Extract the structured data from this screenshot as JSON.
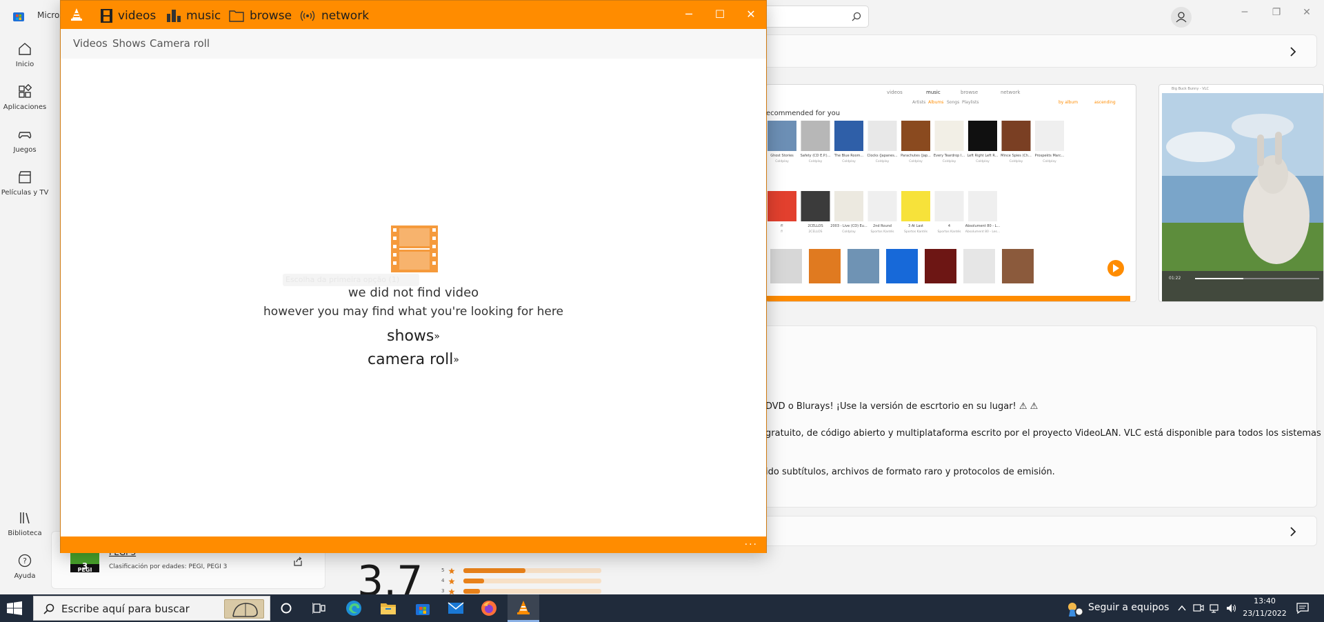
{
  "store": {
    "title": "Microsoft Store",
    "nav": [
      {
        "label": "Inicio"
      },
      {
        "label": "Aplicaciones"
      },
      {
        "label": "Juegos"
      },
      {
        "label": "Películas y TV"
      },
      {
        "label": "Biblioteca"
      },
      {
        "label": "Ayuda"
      }
    ],
    "description_lines": [
      "DVD o Blurays! ¡Use la versión de escrtorio en su lugar! ⚠ ⚠",
      "gratuito, de código abierto y multiplataforma escrito por el proyecto VideoLAN. VLC está disponible para todos los sistemas",
      "ido subtítulos, archivos de formato raro y protocolos de emisión."
    ],
    "rating": "3.7",
    "rating_bars": [
      {
        "stars": "5",
        "fraction": 0.45
      },
      {
        "stars": "4",
        "fraction": 0.15
      },
      {
        "stars": "3",
        "fraction": 0.12
      }
    ],
    "pegi": {
      "badge": "3",
      "logo_text": "PEGI",
      "label": "PEGI 3",
      "description": "Clasificación por edades: PEGI, PEGI 3"
    },
    "screenshot1": {
      "tabs": [
        "videos",
        "music",
        "browse",
        "network"
      ],
      "subtabs": [
        "Artists",
        "Albums",
        "Songs",
        "Playlists"
      ],
      "sort": [
        "by album",
        "ascending"
      ],
      "section": "ecommended for you",
      "albums_row1": [
        {
          "title": "Ghost Stories",
          "artist": "Coldplay"
        },
        {
          "title": "Safety (CD E.P.)...",
          "artist": "Coldplay"
        },
        {
          "title": "The Blue Room...",
          "artist": "Coldplay"
        },
        {
          "title": "Clocks (Japanes...",
          "artist": "Coldplay"
        },
        {
          "title": "Parachutes (Jap...",
          "artist": "Coldplay"
        },
        {
          "title": "Every Teardrop I...",
          "artist": "Coldplay"
        },
        {
          "title": "Left Right Left R...",
          "artist": "Coldplay"
        },
        {
          "title": "Mince Spies (Ch...",
          "artist": "Coldplay"
        },
        {
          "title": "Prospekts Marc...",
          "artist": "Coldplay"
        }
      ],
      "albums_row2": [
        {
          "title": "f!",
          "artist": "f!"
        },
        {
          "title": "2CELLOS",
          "artist": "2CELLOS"
        },
        {
          "title": "2003 - Live (CD) Eu...",
          "artist": "Coldplay"
        },
        {
          "title": "2nd Round",
          "artist": "Sportos Kantés"
        },
        {
          "title": "3 At Last",
          "artist": "Sportos Kantés"
        },
        {
          "title": "4",
          "artist": "Sportos Kantés"
        },
        {
          "title": "Absolument 80 - L...",
          "artist": "Absolument 80 - Les..."
        }
      ]
    },
    "screenshot2": {
      "title": "Big Buck Bunny - VLC",
      "time": "01:22"
    }
  },
  "vlc": {
    "tabs": [
      {
        "label": "videos",
        "icon": "film-icon"
      },
      {
        "label": "music",
        "icon": "equalizer-icon"
      },
      {
        "label": "browse",
        "icon": "folder-icon"
      },
      {
        "label": "network",
        "icon": "broadcast-icon"
      }
    ],
    "subnav": [
      "Videos",
      "Shows",
      "Camera roll"
    ],
    "ghost_text": "Escolha da primeira opção (1)",
    "empty_title": "we did not find video",
    "empty_subtitle": "however you may find what you're looking for here",
    "links": [
      "shows",
      "camera roll"
    ],
    "link_arrow": "»",
    "more": "...",
    "accent": "#ff8c00"
  },
  "taskbar": {
    "search_placeholder": "Escribe aquí para buscar",
    "apps": [
      "cortana-icon",
      "task-view-icon",
      "edge-icon",
      "file-explorer-icon",
      "store-icon",
      "mail-icon",
      "firefox-icon",
      "vlc-icon"
    ],
    "weather_text": "Seguir a equipos",
    "time": "13:40",
    "date": "23/11/2022"
  }
}
